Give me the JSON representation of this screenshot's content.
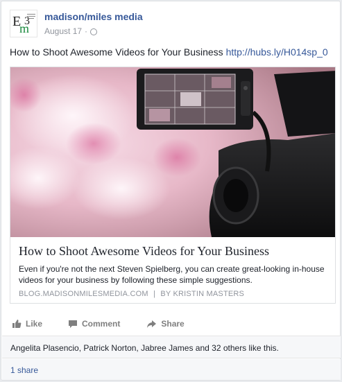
{
  "post": {
    "page_name": "madison/miles media",
    "date": "August 17",
    "dot": "·",
    "message_text": "How to Shoot Awesome Videos for Your Business ",
    "message_link": "http://hubs.ly/H014sp_0"
  },
  "link_card": {
    "title": "How to Shoot Awesome Videos for Your Business",
    "description": "Even if you're not the next Steven Spielberg, you can create great-looking in-house videos for your business by following these simple suggestions.",
    "domain": "BLOG.MADISONMILESMEDIA.COM",
    "separator": "|",
    "author": "BY KRISTIN MASTERS"
  },
  "actions": {
    "like": "Like",
    "comment": "Comment",
    "share": "Share"
  },
  "likes": {
    "text": "Angelita Plasencio, Patrick Norton, Jabree James and 32 others like this."
  },
  "shares": {
    "text": "1 share"
  },
  "icons": {
    "avatar": "mm-logo",
    "privacy": "globe-icon",
    "like": "thumbs-up-icon",
    "comment": "comment-icon",
    "share": "share-arrow-icon"
  },
  "colors": {
    "link": "#365899",
    "meta": "#90949c",
    "action": "#7f7f7f",
    "logo_green": "#1a8a3e"
  }
}
